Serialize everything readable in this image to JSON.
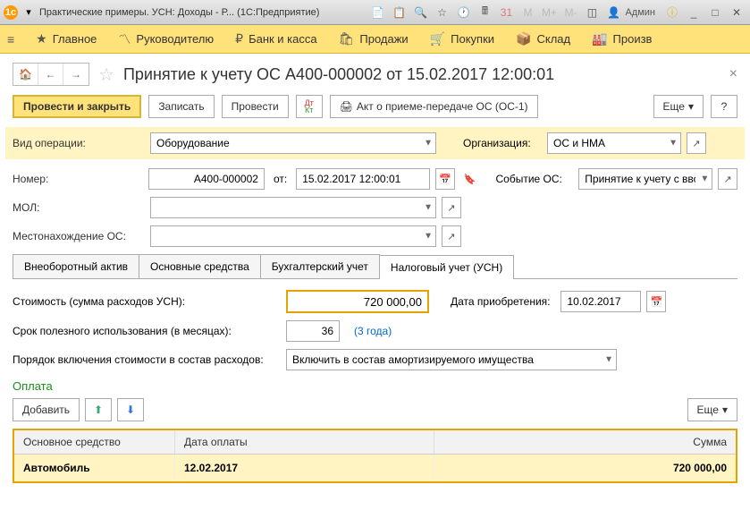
{
  "titlebar": {
    "title": "Практические примеры. УСН: Доходы - Р...   (1С:Предприятие)",
    "user": "Админ"
  },
  "mainmenu": {
    "items": [
      {
        "label": "Главное"
      },
      {
        "label": "Руководителю"
      },
      {
        "label": "Банк и касса"
      },
      {
        "label": "Продажи"
      },
      {
        "label": "Покупки"
      },
      {
        "label": "Склад"
      },
      {
        "label": "Произв"
      }
    ]
  },
  "page": {
    "title": "Принятие к учету ОС А400-000002 от 15.02.2017 12:00:01"
  },
  "toolbar": {
    "post_close": "Провести и закрыть",
    "save": "Записать",
    "post": "Провести",
    "act": "Акт о приеме-передаче ОС (ОС-1)",
    "more": "Еще",
    "help": "?"
  },
  "form": {
    "operation_label": "Вид операции:",
    "operation_value": "Оборудование",
    "org_label": "Организация:",
    "org_value": "ОС и НМА",
    "number_label": "Номер:",
    "number_value": "А400-000002",
    "date_label": "от:",
    "date_value": "15.02.2017 12:00:01",
    "event_label": "Событие ОС:",
    "event_value": "Принятие к учету с вводом",
    "mol_label": "МОЛ:",
    "loc_label": "Местонахождение ОС:"
  },
  "tabs": {
    "t1": "Внеоборотный актив",
    "t2": "Основные средства",
    "t3": "Бухгалтерский учет",
    "t4": "Налоговый учет (УСН)"
  },
  "usn": {
    "cost_label": "Стоимость (сумма расходов УСН):",
    "cost_value": "720 000,00",
    "acq_date_label": "Дата приобретения:",
    "acq_date_value": "10.02.2017",
    "life_label": "Срок полезного использования (в месяцах):",
    "life_value": "36",
    "life_note": "(3 года)",
    "incl_label": "Порядок включения стоимости в состав расходов:",
    "incl_value": "Включить в состав амортизируемого имущества"
  },
  "payment": {
    "title": "Оплата",
    "add": "Добавить",
    "more": "Еще",
    "col_asset": "Основное средство",
    "col_date": "Дата оплаты",
    "col_sum": "Сумма",
    "row": {
      "asset": "Автомобиль",
      "date": "12.02.2017",
      "sum": "720 000,00"
    }
  }
}
